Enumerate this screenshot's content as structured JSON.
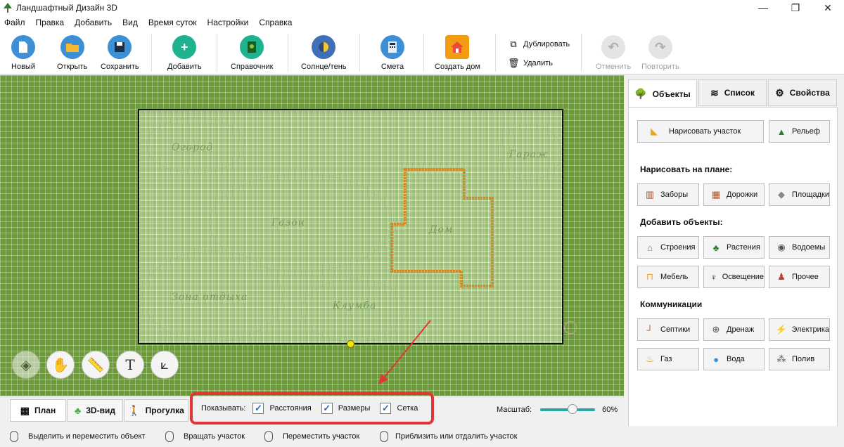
{
  "window": {
    "title": "Ландшафтный Дизайн 3D"
  },
  "menu": [
    "Файл",
    "Правка",
    "Добавить",
    "Вид",
    "Время суток",
    "Настройки",
    "Справка"
  ],
  "toolbar": {
    "new_label": "Новый",
    "open_label": "Открыть",
    "save_label": "Сохранить",
    "add_label": "Добавить",
    "reference_label": "Справочник",
    "sun_label": "Солнце/тень",
    "estimate_label": "Смета",
    "create_house_label": "Создать дом",
    "duplicate_label": "Дублировать",
    "delete_label": "Удалить",
    "undo_label": "Отменить",
    "redo_label": "Повторить"
  },
  "plan": {
    "zones": [
      "Огород",
      "Гараж",
      "Газон",
      "Дом",
      "Зона отдыха",
      "Клумба"
    ]
  },
  "view_tabs": {
    "plan": "План",
    "view3d": "3D-вид",
    "walk": "Прогулка"
  },
  "show_options": {
    "label": "Показывать:",
    "distances": "Расстояния",
    "sizes": "Размеры",
    "grid": "Сетка"
  },
  "scale": {
    "label": "Масштаб:",
    "value": "60%",
    "level_percent": 60
  },
  "panel": {
    "tabs": {
      "objects": "Объекты",
      "list": "Список",
      "properties": "Свойства"
    },
    "draw_plot": "Нарисовать участок",
    "relief": "Рельеф",
    "draw_on_plan_title": "Нарисовать на плане:",
    "fences": "Заборы",
    "paths": "Дорожки",
    "platforms": "Площадки",
    "add_objects_title": "Добавить объекты:",
    "buildings": "Строения",
    "plants": "Растения",
    "ponds": "Водоемы",
    "furniture": "Мебель",
    "lighting": "Освещение",
    "other": "Прочее",
    "communications_title": "Коммуникации",
    "septic": "Септики",
    "drainage": "Дренаж",
    "electric": "Электрика",
    "gas": "Газ",
    "water": "Вода",
    "watering": "Полив"
  },
  "status": {
    "select_move": "Выделить и переместить объект",
    "rotate": "Вращать участок",
    "move_plot": "Переместить участок",
    "zoom": "Приблизить или отдалить участок"
  },
  "colors": {
    "accent": "#2aa5a5",
    "highlight": "#e23636",
    "grass": "#6d9a3a",
    "house_outline": "#d08a2a"
  }
}
